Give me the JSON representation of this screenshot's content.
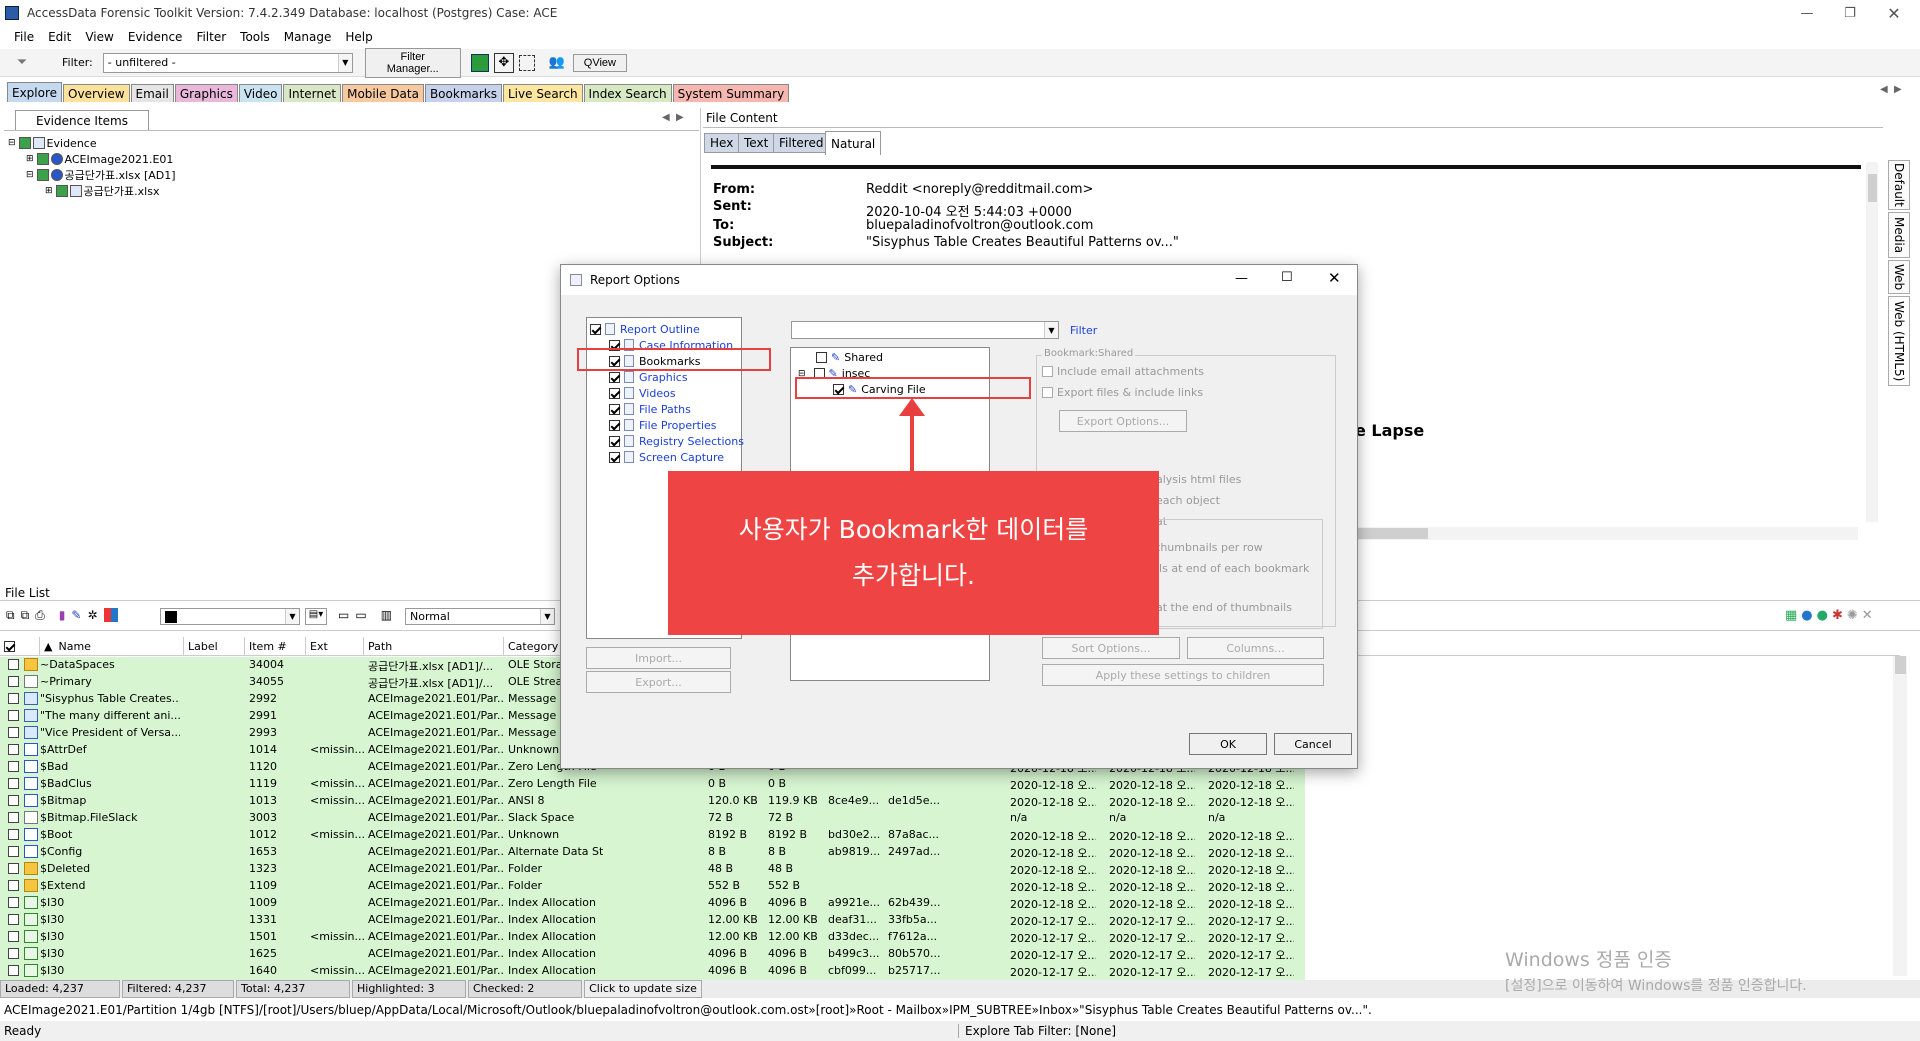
{
  "window": {
    "title": "AccessData Forensic Toolkit Version: 7.4.2.349 Database: localhost (Postgres) Case: ACE"
  },
  "menu": [
    "File",
    "Edit",
    "View",
    "Evidence",
    "Filter",
    "Tools",
    "Manage",
    "Help"
  ],
  "toolbar": {
    "filter_label": "Filter:",
    "filter_value": "- unfiltered -",
    "filter_manager": "Filter Manager...",
    "qview": "QView"
  },
  "main_tabs": [
    {
      "label": "Explore",
      "color": "#c5d9f1"
    },
    {
      "label": "Overview",
      "color": "#fde29b"
    },
    {
      "label": "Email",
      "color": "#e5e5e5"
    },
    {
      "label": "Graphics",
      "color": "#e8b7d9"
    },
    {
      "label": "Video",
      "color": "#c9e4f0"
    },
    {
      "label": "Internet",
      "color": "#d9e7c6"
    },
    {
      "label": "Mobile Data",
      "color": "#f8c99f"
    },
    {
      "label": "Bookmarks",
      "color": "#c6d1ec"
    },
    {
      "label": "Live Search",
      "color": "#fde69f"
    },
    {
      "label": "Index Search",
      "color": "#d7e9c2"
    },
    {
      "label": "System Summary",
      "color": "#f7b7b0"
    }
  ],
  "evidence": {
    "tab": "Evidence Items",
    "tree": [
      "Evidence",
      "ACEImage2021.E01",
      "공급단가표.xlsx [AD1]",
      "공급단가표.xlsx"
    ]
  },
  "content": {
    "title": "File Content",
    "tabs": [
      "Hex",
      "Text",
      "Filtered",
      "Natural"
    ],
    "from_label": "From:",
    "from": "Reddit <noreply@redditmail.com>",
    "sent_label": "Sent:",
    "sent": "2020-10-04 오전 5:44:03 +0000",
    "to_label": "To:",
    "to": "bluepaladinofvoltron@outlook.com",
    "subject_label": "Subject:",
    "subject": "\"Sisyphus Table Creates Beautiful Patterns ov...\"",
    "body_fragment": "e Lapse"
  },
  "side_tabs": [
    "Default",
    "Media",
    "Web",
    "Web (HTML5)"
  ],
  "filelist": {
    "title": "File List",
    "view_value": "Normal",
    "columns": [
      "Name",
      "Label",
      "Item #",
      "Ext",
      "Path",
      "Category"
    ],
    "rows": [
      {
        "name": "~DataSpaces",
        "item": "34004",
        "ext": "",
        "path": "공급단가표.xlsx [AD1]/...",
        "cat": "OLE Storage",
        "s1": "",
        "s2": "",
        "h1": "",
        "h2": "",
        "d1": "",
        "d2": "",
        "d3": "",
        "icon": "folder",
        "bg": "#d6f5d0"
      },
      {
        "name": "~Primary",
        "item": "34055",
        "ext": "",
        "path": "공급단가표.xlsx [AD1]/...",
        "cat": "OLE Stream",
        "s1": "",
        "s2": "",
        "h1": "",
        "h2": "",
        "d1": "",
        "d2": "",
        "d3": "",
        "icon": "file",
        "bg": "#d6f5d0"
      },
      {
        "name": "\"Sisyphus Table Creates...",
        "item": "2992",
        "ext": "",
        "path": "ACEImage2021.E01/Par...",
        "cat": "Message",
        "s1": "",
        "s2": "",
        "h1": "",
        "h2": "",
        "d1": "",
        "d2": "",
        "d3": "",
        "icon": "mail",
        "bg": "#d6f5d0"
      },
      {
        "name": "\"The many different ani...",
        "item": "2991",
        "ext": "",
        "path": "ACEImage2021.E01/Par...",
        "cat": "Message",
        "s1": "",
        "s2": "",
        "h1": "",
        "h2": "",
        "d1": "",
        "d2": "",
        "d3": "",
        "icon": "mail",
        "bg": "#d6f5d0"
      },
      {
        "name": "\"Vice President of Versa...",
        "item": "2993",
        "ext": "",
        "path": "ACEImage2021.E01/Par...",
        "cat": "Message",
        "s1": "",
        "s2": "",
        "h1": "",
        "h2": "",
        "d1": "",
        "d2": "",
        "d3": "",
        "icon": "mail",
        "bg": "#d6f5d0"
      },
      {
        "name": "$AttrDef",
        "item": "1014",
        "ext": "<missin...",
        "path": "ACEImage2021.E01/Par...",
        "cat": "Unknown",
        "s1": "",
        "s2": "",
        "h1": "",
        "h2": "",
        "d1": "",
        "d2": "",
        "d3": "",
        "icon": "q",
        "bg": "#d6f5d0"
      },
      {
        "name": "$Bad",
        "item": "1120",
        "ext": "",
        "path": "ACEImage2021.E01/Par...",
        "cat": "Zero Length File",
        "s1": "0 B",
        "s2": "0 B",
        "h1": "",
        "h2": "",
        "d1": "2020-12-18 오...",
        "d2": "2020-12-18 오...",
        "d3": "2020-12-18 오...",
        "icon": "q",
        "bg": "#d6f5d0"
      },
      {
        "name": "$BadClus",
        "item": "1119",
        "ext": "<missin...",
        "path": "ACEImage2021.E01/Par...",
        "cat": "Zero Length File",
        "s1": "0 B",
        "s2": "0 B",
        "h1": "",
        "h2": "",
        "d1": "2020-12-18 오...",
        "d2": "2020-12-18 오...",
        "d3": "2020-12-18 오...",
        "icon": "q",
        "bg": "#d6f5d0"
      },
      {
        "name": "$Bitmap",
        "item": "1013",
        "ext": "<missin...",
        "path": "ACEImage2021.E01/Par...",
        "cat": "ANSI 8",
        "s1": "120.0 KB",
        "s2": "119.9 KB",
        "h1": "8ce4e9...",
        "h2": "de1d5e...",
        "d1": "2020-12-18 오...",
        "d2": "2020-12-18 오...",
        "d3": "2020-12-18 오...",
        "icon": "q",
        "bg": "#d6f5d0"
      },
      {
        "name": "$Bitmap.FileSlack",
        "item": "3003",
        "ext": "",
        "path": "ACEImage2021.E01/Par...",
        "cat": "Slack Space",
        "s1": "72 B",
        "s2": "72 B",
        "h1": "",
        "h2": "",
        "d1": "n/a",
        "d2": "n/a",
        "d3": "n/a",
        "icon": "file",
        "bg": "#d6f5d0"
      },
      {
        "name": "$Boot",
        "item": "1012",
        "ext": "<missin...",
        "path": "ACEImage2021.E01/Par...",
        "cat": "Unknown",
        "s1": "8192 B",
        "s2": "8192 B",
        "h1": "bd30e2...",
        "h2": "87a8ac...",
        "d1": "2020-12-18 오...",
        "d2": "2020-12-18 오...",
        "d3": "2020-12-18 오...",
        "icon": "q",
        "bg": "#d6f5d0"
      },
      {
        "name": "$Config",
        "item": "1653",
        "ext": "",
        "path": "ACEImage2021.E01/Par...",
        "cat": "Alternate Data Stream",
        "s1": "8 B",
        "s2": "8 B",
        "h1": "ab9819...",
        "h2": "2497ad...",
        "d1": "2020-12-18 오...",
        "d2": "2020-12-18 오...",
        "d3": "2020-12-18 오...",
        "icon": "q",
        "bg": "#d6f5d0"
      },
      {
        "name": "$Deleted",
        "item": "1323",
        "ext": "",
        "path": "ACEImage2021.E01/Par...",
        "cat": "Folder",
        "s1": "48 B",
        "s2": "48 B",
        "h1": "",
        "h2": "",
        "d1": "2020-12-18 오...",
        "d2": "2020-12-18 오...",
        "d3": "2020-12-18 오...",
        "icon": "folder",
        "bg": "#d6f5d0"
      },
      {
        "name": "$Extend",
        "item": "1109",
        "ext": "",
        "path": "ACEImage2021.E01/Par...",
        "cat": "Folder",
        "s1": "552 B",
        "s2": "552 B",
        "h1": "",
        "h2": "",
        "d1": "2020-12-18 오...",
        "d2": "2020-12-18 오...",
        "d3": "2020-12-18 오...",
        "icon": "folder",
        "bg": "#d6f5d0"
      },
      {
        "name": "$I30",
        "item": "1009",
        "ext": "",
        "path": "ACEImage2021.E01/Par...",
        "cat": "Index Allocation",
        "s1": "4096 B",
        "s2": "4096 B",
        "h1": "a9921e...",
        "h2": "62b439...",
        "d1": "2020-12-18 오...",
        "d2": "2020-12-18 오...",
        "d3": "2020-12-18 오...",
        "icon": "i30",
        "bg": "#d6f5d0"
      },
      {
        "name": "$I30",
        "item": "1331",
        "ext": "",
        "path": "ACEImage2021.E01/Par...",
        "cat": "Index Allocation",
        "s1": "12.00 KB",
        "s2": "12.00 KB",
        "h1": "deaf31...",
        "h2": "33fb5a...",
        "d1": "2020-12-17 오...",
        "d2": "2020-12-17 오...",
        "d3": "2020-12-17 오...",
        "icon": "i30",
        "bg": "#d6f5d0"
      },
      {
        "name": "$I30",
        "item": "1501",
        "ext": "<missin...",
        "path": "ACEImage2021.E01/Par...",
        "cat": "Index Allocation",
        "s1": "12.00 KB",
        "s2": "12.00 KB",
        "h1": "d33dec...",
        "h2": "f7612a...",
        "d1": "2020-12-17 오...",
        "d2": "2020-12-17 오...",
        "d3": "2020-12-17 오...",
        "icon": "i30",
        "bg": "#d6f5d0"
      },
      {
        "name": "$I30",
        "item": "1625",
        "ext": "",
        "path": "ACEImage2021.E01/Par...",
        "cat": "Index Allocation",
        "s1": "4096 B",
        "s2": "4096 B",
        "h1": "b499c3...",
        "h2": "80b570...",
        "d1": "2020-12-17 오...",
        "d2": "2020-12-17 오...",
        "d3": "2020-12-17 오...",
        "icon": "i30",
        "bg": "#d6f5d0"
      },
      {
        "name": "$I30",
        "item": "1640",
        "ext": "<missin...",
        "path": "ACEImage2021.E01/Par...",
        "cat": "Index Allocation",
        "s1": "4096 B",
        "s2": "4096 B",
        "h1": "cbf099...",
        "h2": "b25717...",
        "d1": "2020-12-17 오...",
        "d2": "2020-12-17 오...",
        "d3": "2020-12-17 오...",
        "icon": "i30",
        "bg": "#d6f5d0"
      }
    ]
  },
  "status": {
    "loaded": "Loaded: 4,237",
    "filtered": "Filtered: 4,237",
    "total": "Total: 4,237",
    "highlighted": "Highlighted: 3",
    "checked": "Checked: 2",
    "update": "Click to update size"
  },
  "path": "ACEImage2021.E01/Partition 1/4gb [NTFS]/[root]/Users/bluep/AppData/Local/Microsoft/Outlook/bluepaladinofvoltron@outlook.com.ost»[root]»Root - Mailbox»IPM_SUBTREE»Inbox»\"Sisyphus Table Creates Beautiful Patterns ov...\".",
  "ready": {
    "left": "Ready",
    "right": "Explore Tab Filter: [None]"
  },
  "dialog": {
    "title": "Report Options",
    "outline": [
      "Report Outline",
      "Case Information",
      "Bookmarks",
      "Graphics",
      "Videos",
      "File Paths",
      "File Properties",
      "Registry Selections",
      "Screen Capture"
    ],
    "import": "Import...",
    "export": "Export...",
    "filter": "Filter",
    "bm_tree": [
      "Shared",
      "insec",
      "Carving File"
    ],
    "group_label": "Bookmark:Shared",
    "opt_email": "Include email attachments",
    "opt_export": "Export files & include links",
    "export_options": "Export Options...",
    "frag1": "alysis html files",
    "frag2": "each object",
    "frag3": "at",
    "frag4": "thumbnails per row",
    "frag5": "ils at end of each bookmark",
    "frag6": "at the end of thumbnails",
    "sort": "Sort Options...",
    "columns": "Columns...",
    "apply": "Apply these settings to children",
    "ok": "OK",
    "cancel": "Cancel"
  },
  "callout": {
    "line1": "사용자가 Bookmark한 데이터를",
    "line2": "추가합니다."
  },
  "watermark": {
    "line1": "Windows 정품 인증",
    "line2": "[설정]으로 이동하여 Windows를 정품 인증합니다."
  }
}
